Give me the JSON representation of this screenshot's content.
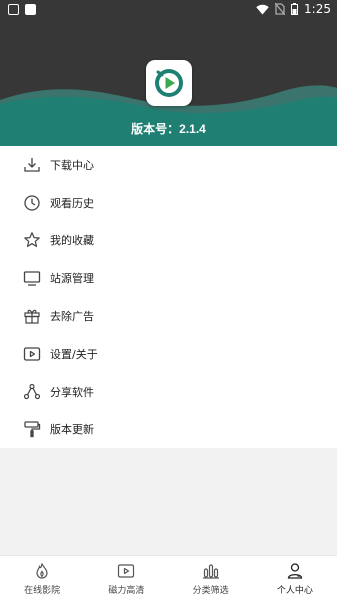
{
  "status_bar": {
    "time": "1:25",
    "left_icons": [
      "image-notification-icon",
      "app-notification-icon"
    ],
    "right_icons": [
      "wifi-icon",
      "no-sim-icon",
      "battery-icon"
    ]
  },
  "header": {
    "logo_icon": "play-logo-icon",
    "version_text": "版本号：2.1.4",
    "colors": {
      "background": "#373737",
      "wave": "#1f7f73",
      "wave_light": "#3c9d8f"
    }
  },
  "menu": {
    "items": [
      {
        "icon": "download-icon",
        "label": "下载中心"
      },
      {
        "icon": "clock-icon",
        "label": "观看历史"
      },
      {
        "icon": "star-icon",
        "label": "我的收藏"
      },
      {
        "icon": "monitor-icon",
        "label": "站源管理"
      },
      {
        "icon": "gift-icon",
        "label": "去除广告"
      },
      {
        "icon": "play-settings-icon",
        "label": "设置/关于"
      },
      {
        "icon": "share-icon",
        "label": "分享软件"
      },
      {
        "icon": "paint-roller-icon",
        "label": "版本更新"
      }
    ]
  },
  "tabbar": {
    "tabs": [
      {
        "icon": "flame-icon",
        "label": "在线影院",
        "active": false
      },
      {
        "icon": "video-icon",
        "label": "磁力高清",
        "active": false
      },
      {
        "icon": "filter-bars-icon",
        "label": "分类筛选",
        "active": false
      },
      {
        "icon": "user-icon",
        "label": "个人中心",
        "active": true
      }
    ]
  }
}
